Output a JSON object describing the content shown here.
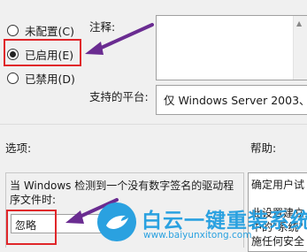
{
  "state": {
    "not_configured": "未配置(C)",
    "enabled": "已启用(E)",
    "disabled": "已禁用(D)"
  },
  "comment": {
    "label": "注释:"
  },
  "platform": {
    "label": "支持的平台:",
    "value": "仅 Windows Server 2003、W"
  },
  "options": {
    "label": "选项:",
    "description": "当 Windows 检测到一个没有数字签名的驱动程序文件时:",
    "select_value": "忽略"
  },
  "help": {
    "label": "帮助:",
    "lines": [
      "确定用户试",
      "此设置建立",
      "中的\"系统\"",
      "施任何安全"
    ]
  },
  "watermark": {
    "name": "白云一键重装系统",
    "url": "www.baiyunxitong.com"
  },
  "colors": {
    "highlight_red": "#e0262a",
    "arrow_purple": "#6a2c91",
    "brand_blue": "#2aa1e0"
  }
}
